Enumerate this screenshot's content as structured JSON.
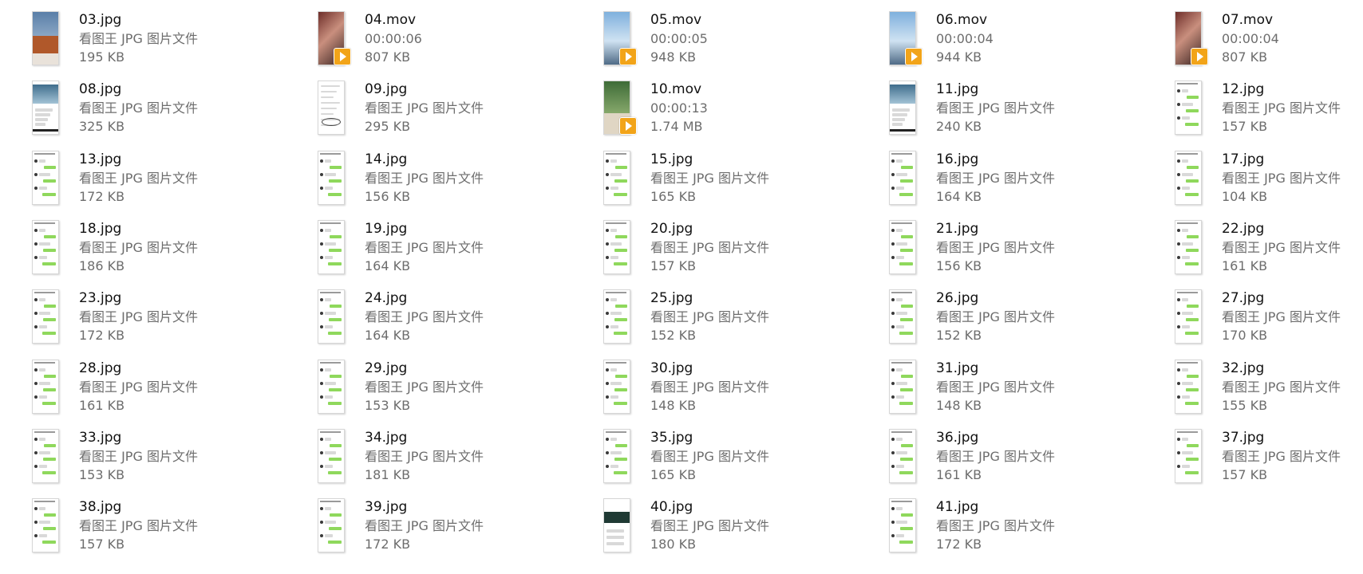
{
  "files": [
    {
      "name": "03.jpg",
      "type_line": "看图王 JPG 图片文件",
      "size": "195 KB",
      "kind": "photo",
      "thumb": "cover-brown"
    },
    {
      "name": "04.mov",
      "type_line": "00:00:06",
      "size": "807 KB",
      "kind": "video",
      "thumb": "video-people"
    },
    {
      "name": "05.mov",
      "type_line": "00:00:05",
      "size": "948 KB",
      "kind": "video",
      "thumb": "video-sky"
    },
    {
      "name": "06.mov",
      "type_line": "00:00:04",
      "size": "944 KB",
      "kind": "video",
      "thumb": "video-sky"
    },
    {
      "name": "07.mov",
      "type_line": "00:00:04",
      "size": "807 KB",
      "kind": "video",
      "thumb": "video-people"
    },
    {
      "name": "08.jpg",
      "type_line": "看图王 JPG 图片文件",
      "size": "325 KB",
      "kind": "photo",
      "thumb": "post-photo"
    },
    {
      "name": "09.jpg",
      "type_line": "看图王 JPG 图片文件",
      "size": "295 KB",
      "kind": "photo",
      "thumb": "document"
    },
    {
      "name": "10.mov",
      "type_line": "00:00:13",
      "size": "1.74 MB",
      "kind": "video",
      "thumb": "video-green"
    },
    {
      "name": "11.jpg",
      "type_line": "看图王 JPG 图片文件",
      "size": "240 KB",
      "kind": "photo",
      "thumb": "post-photo"
    },
    {
      "name": "12.jpg",
      "type_line": "看图王 JPG 图片文件",
      "size": "157 KB",
      "kind": "photo",
      "thumb": "chat"
    },
    {
      "name": "13.jpg",
      "type_line": "看图王 JPG 图片文件",
      "size": "172 KB",
      "kind": "photo",
      "thumb": "chat"
    },
    {
      "name": "14.jpg",
      "type_line": "看图王 JPG 图片文件",
      "size": "156 KB",
      "kind": "photo",
      "thumb": "chat"
    },
    {
      "name": "15.jpg",
      "type_line": "看图王 JPG 图片文件",
      "size": "165 KB",
      "kind": "photo",
      "thumb": "chat"
    },
    {
      "name": "16.jpg",
      "type_line": "看图王 JPG 图片文件",
      "size": "164 KB",
      "kind": "photo",
      "thumb": "chat"
    },
    {
      "name": "17.jpg",
      "type_line": "看图王 JPG 图片文件",
      "size": "104 KB",
      "kind": "photo",
      "thumb": "chat"
    },
    {
      "name": "18.jpg",
      "type_line": "看图王 JPG 图片文件",
      "size": "186 KB",
      "kind": "photo",
      "thumb": "chat"
    },
    {
      "name": "19.jpg",
      "type_line": "看图王 JPG 图片文件",
      "size": "164 KB",
      "kind": "photo",
      "thumb": "chat"
    },
    {
      "name": "20.jpg",
      "type_line": "看图王 JPG 图片文件",
      "size": "157 KB",
      "kind": "photo",
      "thumb": "chat"
    },
    {
      "name": "21.jpg",
      "type_line": "看图王 JPG 图片文件",
      "size": "156 KB",
      "kind": "photo",
      "thumb": "chat"
    },
    {
      "name": "22.jpg",
      "type_line": "看图王 JPG 图片文件",
      "size": "161 KB",
      "kind": "photo",
      "thumb": "chat"
    },
    {
      "name": "23.jpg",
      "type_line": "看图王 JPG 图片文件",
      "size": "172 KB",
      "kind": "photo",
      "thumb": "chat"
    },
    {
      "name": "24.jpg",
      "type_line": "看图王 JPG 图片文件",
      "size": "164 KB",
      "kind": "photo",
      "thumb": "chat"
    },
    {
      "name": "25.jpg",
      "type_line": "看图王 JPG 图片文件",
      "size": "152 KB",
      "kind": "photo",
      "thumb": "chat"
    },
    {
      "name": "26.jpg",
      "type_line": "看图王 JPG 图片文件",
      "size": "152 KB",
      "kind": "photo",
      "thumb": "chat"
    },
    {
      "name": "27.jpg",
      "type_line": "看图王 JPG 图片文件",
      "size": "170 KB",
      "kind": "photo",
      "thumb": "chat"
    },
    {
      "name": "28.jpg",
      "type_line": "看图王 JPG 图片文件",
      "size": "161 KB",
      "kind": "photo",
      "thumb": "chat"
    },
    {
      "name": "29.jpg",
      "type_line": "看图王 JPG 图片文件",
      "size": "153 KB",
      "kind": "photo",
      "thumb": "chat"
    },
    {
      "name": "30.jpg",
      "type_line": "看图王 JPG 图片文件",
      "size": "148 KB",
      "kind": "photo",
      "thumb": "chat"
    },
    {
      "name": "31.jpg",
      "type_line": "看图王 JPG 图片文件",
      "size": "148 KB",
      "kind": "photo",
      "thumb": "chat"
    },
    {
      "name": "32.jpg",
      "type_line": "看图王 JPG 图片文件",
      "size": "155 KB",
      "kind": "photo",
      "thumb": "chat"
    },
    {
      "name": "33.jpg",
      "type_line": "看图王 JPG 图片文件",
      "size": "153 KB",
      "kind": "photo",
      "thumb": "chat"
    },
    {
      "name": "34.jpg",
      "type_line": "看图王 JPG 图片文件",
      "size": "181 KB",
      "kind": "photo",
      "thumb": "chat"
    },
    {
      "name": "35.jpg",
      "type_line": "看图王 JPG 图片文件",
      "size": "165 KB",
      "kind": "photo",
      "thumb": "chat"
    },
    {
      "name": "36.jpg",
      "type_line": "看图王 JPG 图片文件",
      "size": "161 KB",
      "kind": "photo",
      "thumb": "chat"
    },
    {
      "name": "37.jpg",
      "type_line": "看图王 JPG 图片文件",
      "size": "157 KB",
      "kind": "photo",
      "thumb": "chat"
    },
    {
      "name": "38.jpg",
      "type_line": "看图王 JPG 图片文件",
      "size": "157 KB",
      "kind": "photo",
      "thumb": "chat"
    },
    {
      "name": "39.jpg",
      "type_line": "看图王 JPG 图片文件",
      "size": "172 KB",
      "kind": "photo",
      "thumb": "chat"
    },
    {
      "name": "40.jpg",
      "type_line": "看图王 JPG 图片文件",
      "size": "180 KB",
      "kind": "photo",
      "thumb": "dark-card"
    },
    {
      "name": "41.jpg",
      "type_line": "看图王 JPG 图片文件",
      "size": "172 KB",
      "kind": "photo",
      "thumb": "chat"
    }
  ],
  "colors": {
    "play_badge": "#f2a419",
    "chat_bubble": "#8fd85c",
    "name_text": "#111111",
    "meta_text": "#6d6d6d"
  }
}
